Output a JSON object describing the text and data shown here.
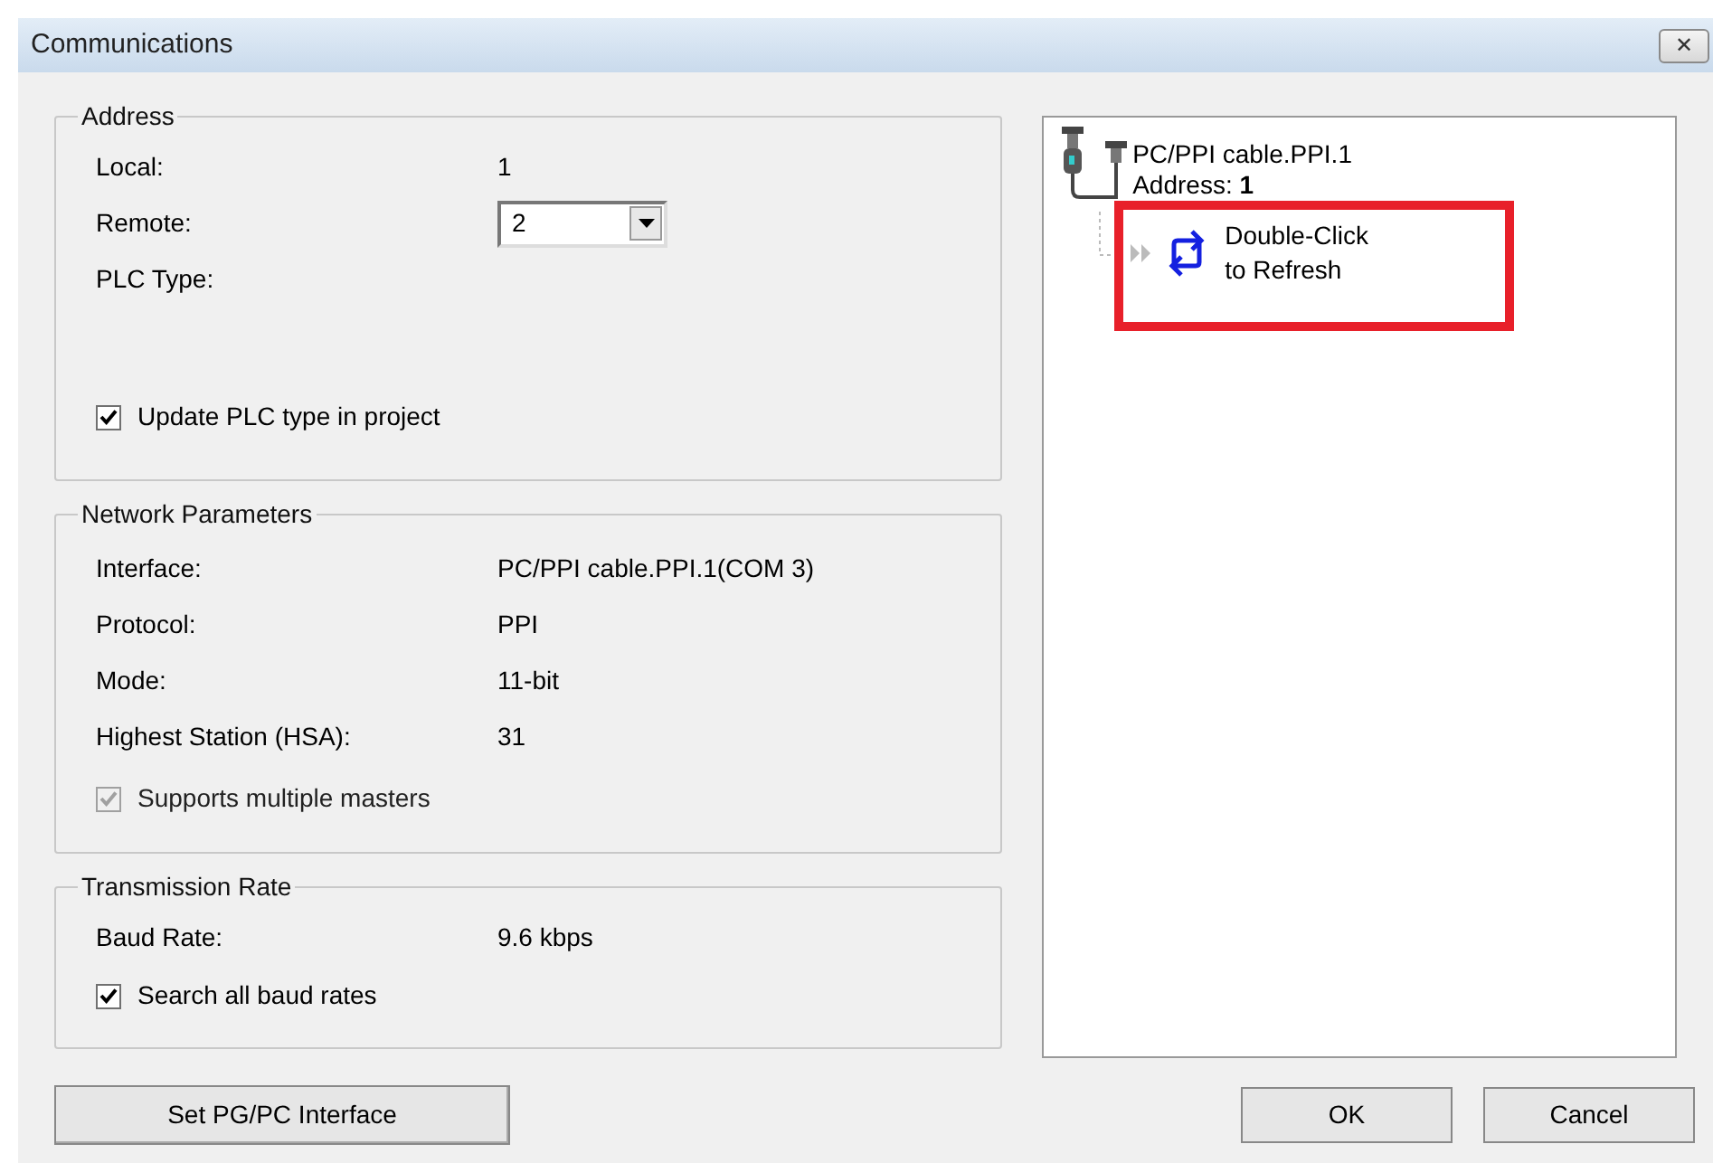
{
  "window": {
    "title": "Communications",
    "close": "✕"
  },
  "address": {
    "title": "Address",
    "local_label": "Local:",
    "local_value": "1",
    "remote_label": "Remote:",
    "remote_value": "2",
    "plc_type_label": "PLC Type:",
    "update_plc": {
      "label": "Update PLC type in project",
      "checked": true,
      "disabled": false
    }
  },
  "network_parameters": {
    "title": "Network Parameters",
    "rows": [
      {
        "label": "Interface:",
        "value": "PC/PPI cable.PPI.1(COM 3)"
      },
      {
        "label": "Protocol:",
        "value": "PPI"
      },
      {
        "label": "Mode:",
        "value": "11-bit"
      },
      {
        "label": "Highest Station (HSA):",
        "value": "31"
      }
    ],
    "multiple_masters": {
      "label": "Supports multiple masters",
      "checked": true,
      "disabled": true
    }
  },
  "transmission_rate": {
    "title": "Transmission Rate",
    "baud_label": "Baud Rate:",
    "baud_value": "9.6 kbps",
    "search_all": {
      "label": "Search all baud rates",
      "checked": true,
      "disabled": false
    }
  },
  "tree": {
    "cable": {
      "name": "PC/PPI cable.PPI.1",
      "address_label": "Address:",
      "address_value": "1"
    },
    "refresh": {
      "line1": "Double-Click",
      "line2": "to Refresh",
      "highlighted": true
    }
  },
  "buttons": {
    "set_interface": "Set PG/PC Interface",
    "ok": "OK",
    "cancel": "Cancel"
  }
}
